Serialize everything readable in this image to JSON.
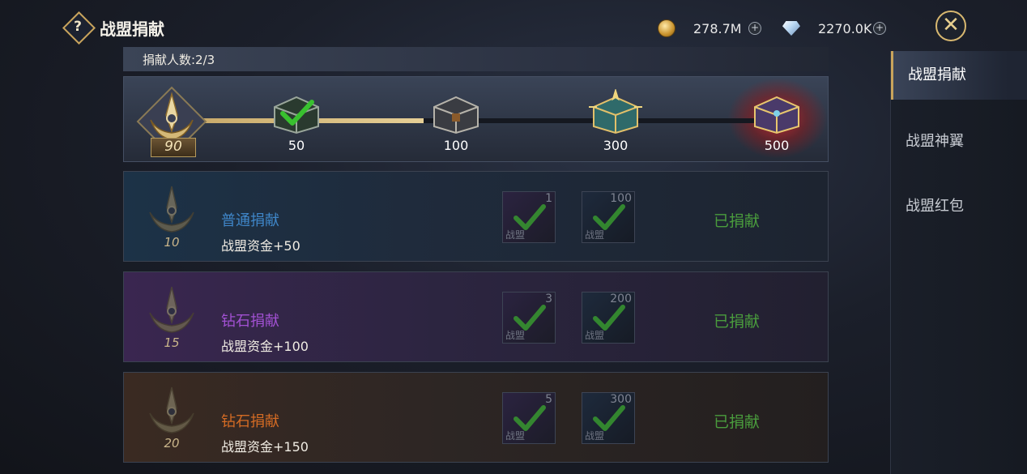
{
  "header": {
    "title": "战盟捐献",
    "gold": "278.7M",
    "diamond": "2270.0K"
  },
  "donors": {
    "label": "捐献人数:2/3"
  },
  "progress": {
    "current": 90,
    "milestones": [
      "50",
      "100",
      "300",
      "500"
    ],
    "claimed": [
      true,
      false,
      false,
      false
    ]
  },
  "rows": [
    {
      "title": "普通捐献",
      "reward_text": "战盟资金+50",
      "level": "10",
      "item1_count": "1",
      "item1_label": "战盟",
      "item2_count": "100",
      "item2_label": "战盟",
      "status": "已捐献"
    },
    {
      "title": "钻石捐献",
      "reward_text": "战盟资金+100",
      "level": "15",
      "item1_count": "3",
      "item1_label": "战盟",
      "item2_count": "200",
      "item2_label": "战盟",
      "status": "已捐献"
    },
    {
      "title": "钻石捐献",
      "reward_text": "战盟资金+150",
      "level": "20",
      "item1_count": "5",
      "item1_label": "战盟",
      "item2_count": "300",
      "item2_label": "战盟",
      "status": "已捐献"
    }
  ],
  "side_nav": [
    "战盟捐献",
    "战盟神翼",
    "战盟红包"
  ],
  "colors": {
    "accent_gold": "#c9a45c",
    "done_green": "#4a9c3d",
    "blue_title": "#3f86c8",
    "purple_title": "#a251d3",
    "orange_title": "#d46b24"
  }
}
